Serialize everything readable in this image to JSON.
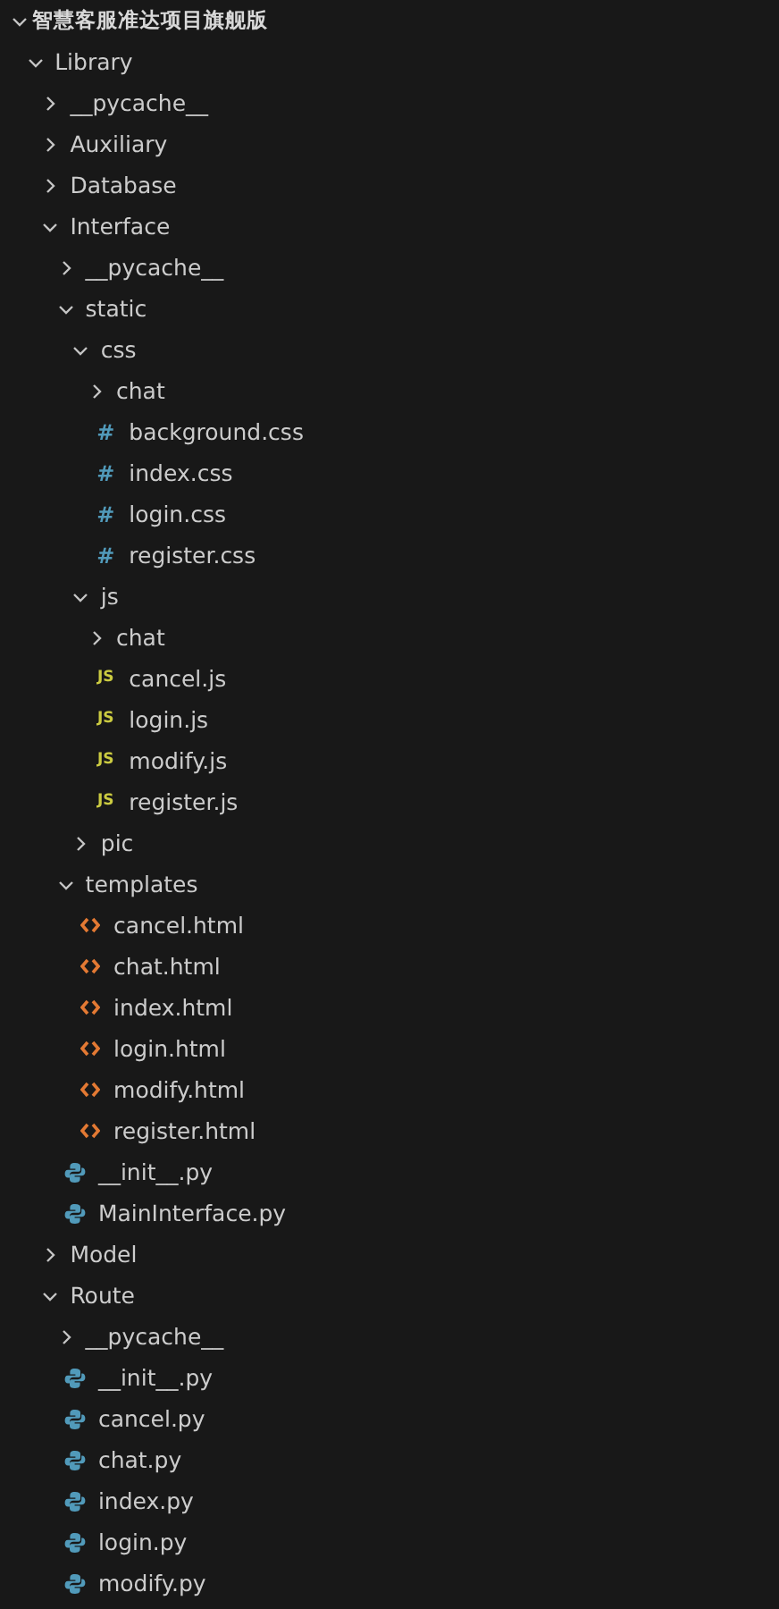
{
  "explorer": {
    "root": {
      "label": "智慧客服准达项目旗舰版",
      "expanded": true,
      "children": [
        {
          "kind": "folder",
          "label": "Library",
          "expanded": true,
          "children": [
            {
              "kind": "folder",
              "label": "__pycache__",
              "expanded": false
            },
            {
              "kind": "folder",
              "label": "Auxiliary",
              "expanded": false
            },
            {
              "kind": "folder",
              "label": "Database",
              "expanded": false
            },
            {
              "kind": "folder",
              "label": "Interface",
              "expanded": true,
              "children": [
                {
                  "kind": "folder",
                  "label": "__pycache__",
                  "expanded": false
                },
                {
                  "kind": "folder",
                  "label": "static",
                  "expanded": true,
                  "children": [
                    {
                      "kind": "folder",
                      "label": "css",
                      "expanded": true,
                      "children": [
                        {
                          "kind": "folder",
                          "label": "chat",
                          "expanded": false
                        },
                        {
                          "kind": "css",
                          "badge": "#",
                          "label": "background.css"
                        },
                        {
                          "kind": "css",
                          "badge": "#",
                          "label": "index.css"
                        },
                        {
                          "kind": "css",
                          "badge": "#",
                          "label": "login.css"
                        },
                        {
                          "kind": "css",
                          "badge": "#",
                          "label": "register.css"
                        }
                      ]
                    },
                    {
                      "kind": "folder",
                      "label": "js",
                      "expanded": true,
                      "children": [
                        {
                          "kind": "folder",
                          "label": "chat",
                          "expanded": false
                        },
                        {
                          "kind": "js",
                          "badge": "JS",
                          "label": "cancel.js"
                        },
                        {
                          "kind": "js",
                          "badge": "JS",
                          "label": "login.js"
                        },
                        {
                          "kind": "js",
                          "badge": "JS",
                          "label": "modify.js"
                        },
                        {
                          "kind": "js",
                          "badge": "JS",
                          "label": "register.js"
                        }
                      ]
                    },
                    {
                      "kind": "folder",
                      "label": "pic",
                      "expanded": false
                    }
                  ]
                },
                {
                  "kind": "folder",
                  "label": "templates",
                  "expanded": true,
                  "children": [
                    {
                      "kind": "html",
                      "label": "cancel.html"
                    },
                    {
                      "kind": "html",
                      "label": "chat.html"
                    },
                    {
                      "kind": "html",
                      "label": "index.html"
                    },
                    {
                      "kind": "html",
                      "label": "login.html"
                    },
                    {
                      "kind": "html",
                      "label": "modify.html"
                    },
                    {
                      "kind": "html",
                      "label": "register.html"
                    }
                  ]
                },
                {
                  "kind": "py",
                  "label": "__init__.py"
                },
                {
                  "kind": "py",
                  "label": "MainInterface.py"
                }
              ]
            },
            {
              "kind": "folder",
              "label": "Model",
              "expanded": false
            },
            {
              "kind": "folder",
              "label": "Route",
              "expanded": true,
              "children": [
                {
                  "kind": "folder",
                  "label": "__pycache__",
                  "expanded": false
                },
                {
                  "kind": "py",
                  "label": "__init__.py"
                },
                {
                  "kind": "py",
                  "label": "cancel.py"
                },
                {
                  "kind": "py",
                  "label": "chat.py"
                },
                {
                  "kind": "py",
                  "label": "index.py"
                },
                {
                  "kind": "py",
                  "label": "login.py"
                },
                {
                  "kind": "py",
                  "label": "modify.py"
                }
              ]
            }
          ]
        }
      ]
    }
  }
}
